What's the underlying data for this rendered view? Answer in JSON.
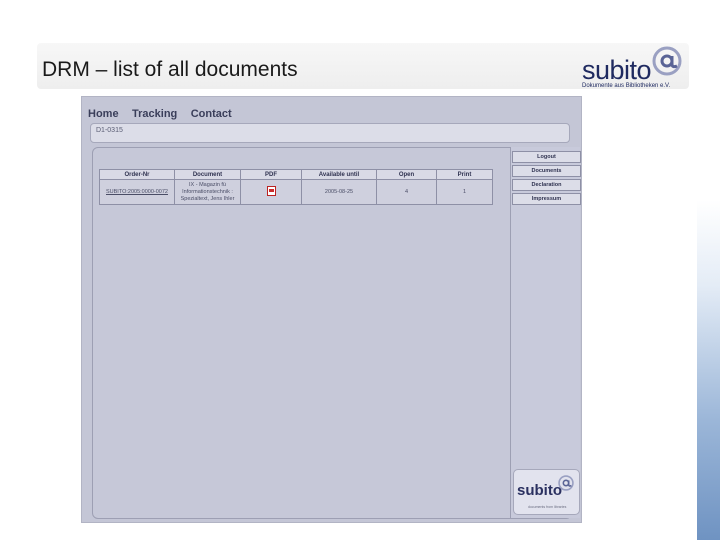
{
  "slide": {
    "title": "DRM – list of all documents",
    "logo_word": "subito",
    "logo_tagline": "Dokumente aus Bibliotheken e.V."
  },
  "app": {
    "nav": [
      "Home",
      "Tracking",
      "Contact"
    ],
    "order_field": "D1-0315",
    "table": {
      "headers": [
        "Order-Nr",
        "Document",
        "PDF",
        "Available until",
        "Open",
        "Print"
      ],
      "rows": [
        {
          "order_nr": "SUBITO:2005:0000-0072",
          "document_line1": "IX - Magazin fü",
          "document_line2": "Informationstechnik :",
          "document_line3": "Spezialtext, Jens Ihler",
          "available_until": "2005-08-25",
          "open": "4",
          "print": "1"
        }
      ]
    },
    "sidebar": {
      "buttons": [
        "Logout",
        "Documents",
        "Declaration",
        "Impressum"
      ],
      "logo_word": "subito",
      "logo_tagline": "documents from libraries"
    }
  },
  "colors": {
    "app_bg": "#c4c6d6",
    "brand": "#1f2a60",
    "link": "#2a3aa8"
  }
}
